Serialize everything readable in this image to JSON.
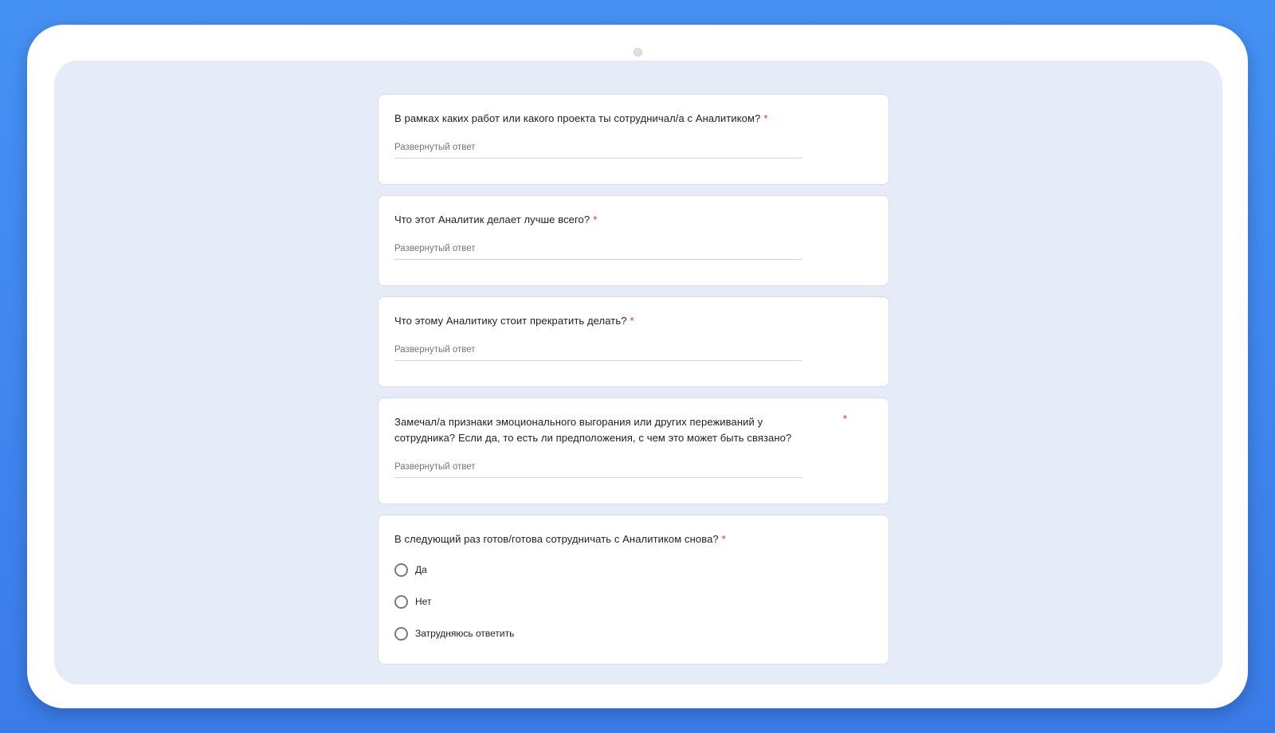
{
  "form": {
    "required_mark": "*",
    "answer_placeholder": "Развернутый ответ",
    "questions": [
      {
        "title": "В рамках каких работ или какого проекта ты сотрудничал/а с Аналитиком?",
        "type": "paragraph",
        "required": true,
        "placeholder": "Развернутый ответ"
      },
      {
        "title": "Что этот Аналитик делает лучше всего?",
        "type": "paragraph",
        "required": true,
        "placeholder": "Развернутый ответ"
      },
      {
        "title": "Что этому Аналитику стоит прекратить делать?",
        "type": "paragraph",
        "required": true,
        "placeholder": "Развернутый ответ"
      },
      {
        "title": "Замечал/а признаки эмоционального выгорания или других переживаний у сотрудника? Если да, то есть ли предположения, с чем это может быть связано?",
        "type": "paragraph",
        "required": true,
        "placeholder": "Развернутый ответ"
      },
      {
        "title": "В следующий раз готов/готова сотрудничать с Аналитиком снова?",
        "type": "radio",
        "required": true,
        "options": [
          "Да",
          "Нет",
          "Затрудняюсь ответить"
        ]
      }
    ]
  },
  "colors": {
    "background_blue": "#4591f3",
    "device_frame": "#ffffff",
    "screen_background": "#e5ecf7",
    "card_background": "#ffffff",
    "required_star": "#d93025",
    "text_primary": "#202124",
    "placeholder_text": "#70757a"
  }
}
